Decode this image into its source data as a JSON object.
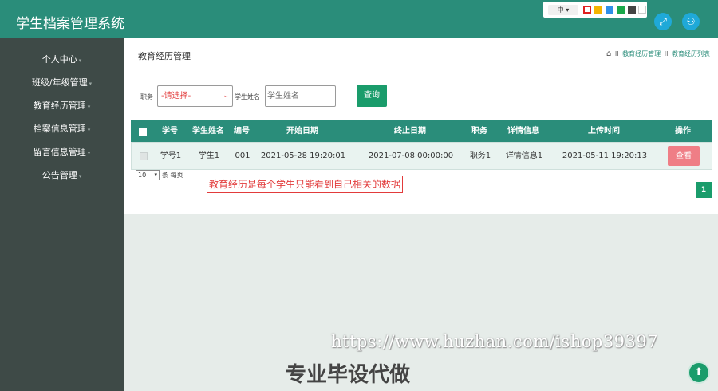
{
  "app": {
    "title": "学生档案管理系统"
  },
  "topbar": {
    "lang": "中",
    "lang_caret": "▾",
    "theme_colors": [
      "#e02020",
      "#f5b400",
      "#2f8fe8",
      "#19a84a",
      "#444444",
      "#ffffff"
    ],
    "fullscreen_icon": "⤢",
    "user_icon": "⚇"
  },
  "sidebar": {
    "items": [
      {
        "label": "个人中心"
      },
      {
        "label": "班级/年级管理"
      },
      {
        "label": "教育经历管理"
      },
      {
        "label": "档案信息管理"
      },
      {
        "label": "留言信息管理"
      },
      {
        "label": "公告管理"
      }
    ],
    "caret": "▾"
  },
  "page": {
    "title": "教育经历管理",
    "breadcrumb": {
      "home_icon": "⌂",
      "sep": "II",
      "items": [
        "教育经历管理",
        "教育经历列表"
      ]
    }
  },
  "search": {
    "role_label": "职务",
    "role_value": "-请选择-",
    "role_caret": "⌄",
    "name_label": "学生姓名",
    "name_placeholder": "学生姓名",
    "query_label": "查询"
  },
  "table": {
    "columns": [
      "学号",
      "学生姓名",
      "编号",
      "开始日期",
      "终止日期",
      "职务",
      "详情信息",
      "上传时间",
      "操作"
    ],
    "rows": [
      {
        "cells": [
          "学号1",
          "学生1",
          "001",
          "2021-05-28 19:20:01",
          "2021-07-08 00:00:00",
          "职务1",
          "详情信息1",
          "2021-05-11 19:20:13"
        ],
        "action": "查看"
      }
    ]
  },
  "pagination": {
    "page_size": "10",
    "page_size_suffix": "条 每页",
    "current_page": "1"
  },
  "annotation": "教育经历是每个学生只能看到自己相关的数据",
  "watermark": {
    "url": "https://www.huzhan.com/ishop39397",
    "text": "专业毕设代做"
  },
  "back_to_top_icon": "⬆"
}
